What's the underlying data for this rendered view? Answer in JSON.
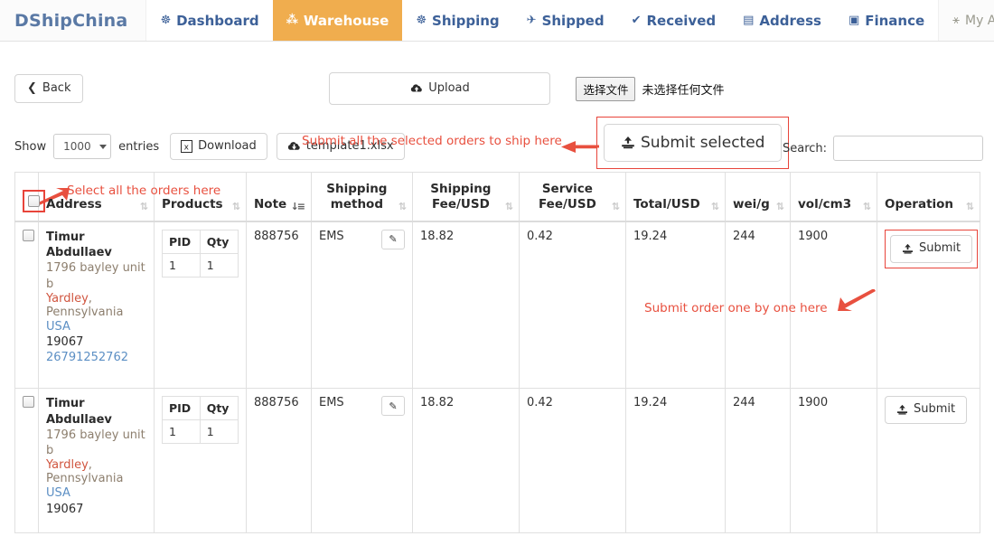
{
  "brand": "DShipChina",
  "nav": {
    "items": [
      {
        "label": "Dashboard",
        "icon": "dashboard-icon",
        "glyph": "☸",
        "active": false
      },
      {
        "label": "Warehouse",
        "icon": "warehouse-icon",
        "glyph": "⁂",
        "active": true
      },
      {
        "label": "Shipping",
        "icon": "shipping-icon",
        "glyph": "☸",
        "active": false
      },
      {
        "label": "Shipped",
        "icon": "plane-icon",
        "glyph": "✈",
        "active": false
      },
      {
        "label": "Received",
        "icon": "check-icon",
        "glyph": "✔",
        "active": false
      },
      {
        "label": "Address",
        "icon": "book-icon",
        "glyph": "▤",
        "active": false
      },
      {
        "label": "Finance",
        "icon": "money-icon",
        "glyph": "▣",
        "active": false
      }
    ],
    "account": {
      "label": "My Account",
      "icon": "user-icon",
      "glyph": "⚹"
    }
  },
  "toolbar": {
    "back_label": "Back",
    "back_icon_glyph": "❮",
    "upload_label": "Upload",
    "upload_icon": "cloud-upload-icon",
    "file_button_label": "选择文件",
    "file_status": "未选择任何文件"
  },
  "controls": {
    "show_label": "Show",
    "entries_value": "1000",
    "entries_label": "entries",
    "download_label": "Download",
    "download_icon": "excel-icon",
    "template_label": "template1.xlsx",
    "template_icon": "cloud-download-icon",
    "submit_selected_label": "Submit selected",
    "submit_selected_icon": "upload-stand-icon",
    "search_label": "Search:",
    "search_value": "",
    "search_placeholder": ""
  },
  "annotations": {
    "submit_all": "Submit all the selected orders to ship here",
    "select_all": "Select all the orders here",
    "one_by_one": "Submit order one by one here",
    "color": "#e8503f"
  },
  "table": {
    "headers": [
      {
        "label": "",
        "name": "select-all",
        "sort": "none"
      },
      {
        "label": "Address",
        "name": "address",
        "sort": "both"
      },
      {
        "label": "Products",
        "name": "products",
        "sort": "both"
      },
      {
        "label": "Note",
        "name": "note",
        "sort": "desc"
      },
      {
        "label": "Shipping method",
        "name": "shipping-method",
        "sort": "both"
      },
      {
        "label": "Shipping Fee/USD",
        "name": "shipping-fee",
        "sort": "both"
      },
      {
        "label": "Service Fee/USD",
        "name": "service-fee",
        "sort": "both"
      },
      {
        "label": "Total/USD",
        "name": "total-usd",
        "sort": "both"
      },
      {
        "label": "wei/g",
        "name": "weight",
        "sort": "both"
      },
      {
        "label": "vol/cm3",
        "name": "volume",
        "sort": "both"
      },
      {
        "label": "Operation",
        "name": "operation",
        "sort": "both"
      }
    ],
    "products_headers": [
      "PID",
      "Qty"
    ],
    "rows": [
      {
        "checked": false,
        "address": {
          "name": "Timur Abdullaev",
          "street": "1796 bayley unit b",
          "city": "Yardley",
          "state": ", Pennsylvania",
          "country": "USA",
          "zip": "19067",
          "phone": "26791252762"
        },
        "products": [
          {
            "pid": "1",
            "qty": "1"
          }
        ],
        "note": "888756",
        "shipping_method": "EMS",
        "shipping_fee": "18.82",
        "service_fee": "0.42",
        "total": "19.24",
        "weight": "244",
        "volume": "1900",
        "submit_label": "Submit",
        "highlighted": true
      },
      {
        "checked": false,
        "address": {
          "name": "Timur Abdullaev",
          "street": "1796 bayley unit b",
          "city": "Yardley",
          "state": ", Pennsylvania",
          "country": "USA",
          "zip": "19067",
          "phone": ""
        },
        "products": [
          {
            "pid": "1",
            "qty": "1"
          }
        ],
        "note": "888756",
        "shipping_method": "EMS",
        "shipping_fee": "18.82",
        "service_fee": "0.42",
        "total": "19.24",
        "weight": "244",
        "volume": "1900",
        "submit_label": "Submit",
        "highlighted": false
      }
    ]
  },
  "colors": {
    "accent_orange": "#f0ad4e",
    "nav_blue": "#3c6098",
    "annotation_red": "#e8503f",
    "highlight_red": "#e8443a"
  }
}
